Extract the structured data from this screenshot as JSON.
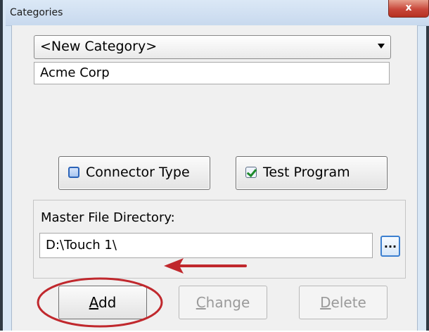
{
  "window": {
    "title": "Categories",
    "close_glyph": "x"
  },
  "category_select": {
    "selected": "<New Category>"
  },
  "category_name": {
    "value": "Acme Corp"
  },
  "options": {
    "connector_type": {
      "label": "Connector Type",
      "checked": false
    },
    "test_program": {
      "label": "Test Program",
      "checked": true
    }
  },
  "master_file": {
    "label": "Master File Directory:",
    "path": "D:\\Touch 1\\",
    "browse_label": "..."
  },
  "actions": {
    "add": {
      "mnemonic": "A",
      "rest": "dd",
      "enabled": true
    },
    "change": {
      "mnemonic": "C",
      "rest": "hange",
      "enabled": false
    },
    "delete": {
      "mnemonic": "D",
      "rest": "elete",
      "enabled": false
    }
  },
  "annotation_color": "#c0282d"
}
